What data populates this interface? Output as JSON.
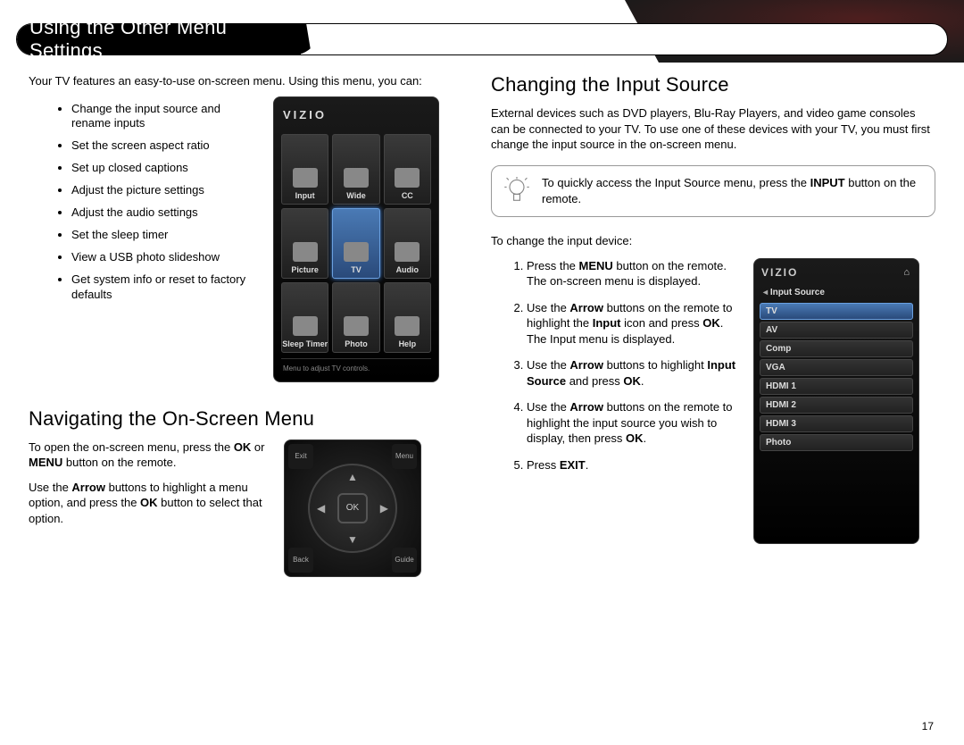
{
  "header": {
    "title": "Using the Other Menu Settings"
  },
  "left": {
    "intro": "Your TV features an easy-to-use on-screen menu. Using this menu, you can:",
    "bullets": [
      "Change the input source and rename inputs",
      "Set the screen aspect ratio",
      "Set up closed captions",
      "Adjust the picture settings",
      "Adjust the audio settings",
      "Set the sleep timer",
      "View a USB photo slideshow",
      "Get system info or reset to factory defaults"
    ],
    "nav_heading": "Navigating the On-Screen Menu",
    "nav_p1a": "To open the on-screen menu, press the ",
    "nav_p1b": " or ",
    "nav_p1c": " button on the remote.",
    "nav_p2a": "Use the ",
    "nav_p2b": " buttons to highlight a menu option, and press the ",
    "nav_p2c": " button to select that option.",
    "bold": {
      "ok": "OK",
      "menu": "MENU",
      "arrow": "Arrow"
    }
  },
  "main_menu": {
    "brand": "VIZIO",
    "cells": [
      {
        "label": "Input"
      },
      {
        "label": "Wide"
      },
      {
        "label": "CC"
      },
      {
        "label": "Picture"
      },
      {
        "label": "TV",
        "selected": true
      },
      {
        "label": "Audio"
      },
      {
        "label": "Sleep Timer"
      },
      {
        "label": "Photo"
      },
      {
        "label": "Help"
      }
    ],
    "footer": "Menu to adjust TV controls."
  },
  "remote": {
    "corners": [
      "Exit",
      "Menu",
      "Back",
      "Guide"
    ],
    "ok": "OK"
  },
  "right": {
    "heading": "Changing the Input Source",
    "intro": "External devices such as DVD players, Blu-Ray Players, and video game consoles can be connected to your TV. To use one of these devices with your TV, you must first change the input source in the on-screen menu.",
    "tip_a": "To quickly access the Input Source menu, press the ",
    "tip_b": " button on the remote.",
    "tip_bold": "INPUT",
    "to_change": "To change the input device:",
    "steps": [
      {
        "pre": "Press the ",
        "b1": "MENU",
        "post": " button on the remote. The on-screen menu is displayed."
      },
      {
        "pre": "Use the ",
        "b1": "Arrow",
        "mid1": " buttons on the remote to highlight the ",
        "b2": "Input",
        "mid2": " icon and press ",
        "b3": "OK",
        "post": ". The Input menu is displayed."
      },
      {
        "pre": "Use the ",
        "b1": "Arrow",
        "mid1": " buttons to highlight ",
        "b2": "Input Source",
        "mid2": " and press ",
        "b3": "OK",
        "post": "."
      },
      {
        "pre": "Use the ",
        "b1": "Arrow",
        "mid1": " buttons on the remote to highlight the input source you wish to display, then press ",
        "b2": "OK",
        "post": "."
      },
      {
        "pre": "Press ",
        "b1": "EXIT",
        "post": "."
      }
    ]
  },
  "input_menu": {
    "brand": "VIZIO",
    "title": "Input Source",
    "items": [
      {
        "label": "TV",
        "selected": true
      },
      {
        "label": "AV"
      },
      {
        "label": "Comp"
      },
      {
        "label": "VGA"
      },
      {
        "label": "HDMI 1"
      },
      {
        "label": "HDMI 2"
      },
      {
        "label": "HDMI 3"
      },
      {
        "label": "Photo"
      }
    ]
  },
  "page_number": "17"
}
